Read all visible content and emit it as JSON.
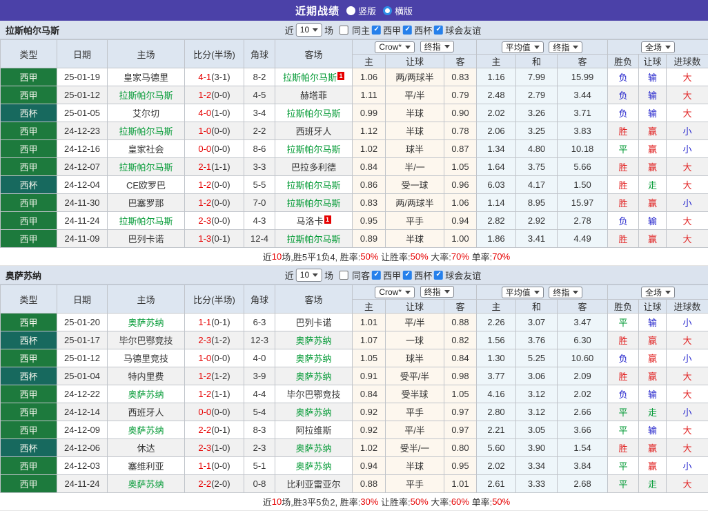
{
  "topbar": {
    "title": "近期战绩",
    "radio_vertical_label": "竖版",
    "radio_horizontal_label": "横版"
  },
  "filters": {
    "near": "近",
    "count": "10",
    "matches": "场",
    "league": "西甲",
    "cup": "西杯",
    "friendly": "球会友谊"
  },
  "controls": {
    "odds_source": "Crow*",
    "final_index1": "终指",
    "average": "平均值",
    "final_index2": "终指",
    "full_match": "全场"
  },
  "cols": {
    "type": "类型",
    "date": "日期",
    "home": "主场",
    "score": "比分(半场)",
    "corner": "角球",
    "away": "客场",
    "h": "主",
    "handicap": "让球",
    "a": "客",
    "h2": "主",
    "d": "和",
    "a2": "客",
    "wdl": "胜负",
    "handicap2": "让球",
    "goals": "进球数"
  },
  "sections": [
    {
      "team": "拉斯帕尔马斯",
      "same_label": "同主",
      "rows": [
        {
          "type": "西甲",
          "tc": "jia",
          "date": "25-01-19",
          "home": "皇家马德里",
          "hh": 0,
          "hb": "",
          "ft": "4-1",
          "ht": "(3-1)",
          "corner": "8-2",
          "away": "拉斯帕尔马斯",
          "ah": 1,
          "ab": "1",
          "o": [
            "1.06",
            "两/两球半",
            "0.83",
            "1.16",
            "7.99",
            "15.99"
          ],
          "r": [
            [
              "负",
              "b"
            ],
            [
              "输",
              "b"
            ],
            [
              "大",
              "r"
            ]
          ]
        },
        {
          "type": "西甲",
          "tc": "jia",
          "date": "25-01-12",
          "home": "拉斯帕尔马斯",
          "hh": 1,
          "hb": "",
          "ft": "1-2",
          "ht": "(0-0)",
          "corner": "4-5",
          "away": "赫塔菲",
          "ah": 0,
          "ab": "",
          "o": [
            "1.11",
            "平/半",
            "0.79",
            "2.48",
            "2.79",
            "3.44"
          ],
          "r": [
            [
              "负",
              "b"
            ],
            [
              "输",
              "b"
            ],
            [
              "大",
              "r"
            ]
          ]
        },
        {
          "type": "西杯",
          "tc": "bei",
          "date": "25-01-05",
          "home": "艾尔切",
          "hh": 0,
          "hb": "",
          "ft": "4-0",
          "ht": "(1-0)",
          "corner": "3-4",
          "away": "拉斯帕尔马斯",
          "ah": 1,
          "ab": "",
          "o": [
            "0.99",
            "半球",
            "0.90",
            "2.02",
            "3.26",
            "3.71"
          ],
          "r": [
            [
              "负",
              "b"
            ],
            [
              "输",
              "b"
            ],
            [
              "大",
              "r"
            ]
          ]
        },
        {
          "type": "西甲",
          "tc": "jia",
          "date": "24-12-23",
          "home": "拉斯帕尔马斯",
          "hh": 1,
          "hb": "",
          "ft": "1-0",
          "ht": "(0-0)",
          "corner": "2-2",
          "away": "西班牙人",
          "ah": 0,
          "ab": "",
          "o": [
            "1.12",
            "半球",
            "0.78",
            "2.06",
            "3.25",
            "3.83"
          ],
          "r": [
            [
              "胜",
              "r"
            ],
            [
              "赢",
              "r"
            ],
            [
              "小",
              "b"
            ]
          ]
        },
        {
          "type": "西甲",
          "tc": "jia",
          "date": "24-12-16",
          "home": "皇家社会",
          "hh": 0,
          "hb": "",
          "ft": "0-0",
          "ht": "(0-0)",
          "corner": "8-6",
          "away": "拉斯帕尔马斯",
          "ah": 1,
          "ab": "",
          "o": [
            "1.02",
            "球半",
            "0.87",
            "1.34",
            "4.80",
            "10.18"
          ],
          "r": [
            [
              "平",
              "g"
            ],
            [
              "赢",
              "r"
            ],
            [
              "小",
              "b"
            ]
          ]
        },
        {
          "type": "西甲",
          "tc": "jia",
          "date": "24-12-07",
          "home": "拉斯帕尔马斯",
          "hh": 1,
          "hb": "",
          "ft": "2-1",
          "ht": "(1-1)",
          "corner": "3-3",
          "away": "巴拉多利德",
          "ah": 0,
          "ab": "",
          "o": [
            "0.84",
            "半/一",
            "1.05",
            "1.64",
            "3.75",
            "5.66"
          ],
          "r": [
            [
              "胜",
              "r"
            ],
            [
              "赢",
              "r"
            ],
            [
              "大",
              "r"
            ]
          ]
        },
        {
          "type": "西杯",
          "tc": "bei",
          "date": "24-12-04",
          "home": "CE欧罗巴",
          "hh": 0,
          "hb": "",
          "ft": "1-2",
          "ht": "(0-0)",
          "corner": "5-5",
          "away": "拉斯帕尔马斯",
          "ah": 1,
          "ab": "",
          "o": [
            "0.86",
            "受一球",
            "0.96",
            "6.03",
            "4.17",
            "1.50"
          ],
          "r": [
            [
              "胜",
              "r"
            ],
            [
              "走",
              "g"
            ],
            [
              "大",
              "r"
            ]
          ]
        },
        {
          "type": "西甲",
          "tc": "jia",
          "date": "24-11-30",
          "home": "巴塞罗那",
          "hh": 0,
          "hb": "",
          "ft": "1-2",
          "ht": "(0-0)",
          "corner": "7-0",
          "away": "拉斯帕尔马斯",
          "ah": 1,
          "ab": "",
          "o": [
            "0.83",
            "两/两球半",
            "1.06",
            "1.14",
            "8.95",
            "15.97"
          ],
          "r": [
            [
              "胜",
              "r"
            ],
            [
              "赢",
              "r"
            ],
            [
              "小",
              "b"
            ]
          ]
        },
        {
          "type": "西甲",
          "tc": "jia",
          "date": "24-11-24",
          "home": "拉斯帕尔马斯",
          "hh": 1,
          "hb": "",
          "ft": "2-3",
          "ht": "(0-0)",
          "corner": "4-3",
          "away": "马洛卡",
          "ah": 0,
          "ab": "1",
          "o": [
            "0.95",
            "平手",
            "0.94",
            "2.82",
            "2.92",
            "2.78"
          ],
          "r": [
            [
              "负",
              "b"
            ],
            [
              "输",
              "b"
            ],
            [
              "大",
              "r"
            ]
          ]
        },
        {
          "type": "西甲",
          "tc": "jia",
          "date": "24-11-09",
          "home": "巴列卡诺",
          "hh": 0,
          "hb": "",
          "ft": "1-3",
          "ht": "(0-1)",
          "corner": "12-4",
          "away": "拉斯帕尔马斯",
          "ah": 1,
          "ab": "",
          "o": [
            "0.89",
            "半球",
            "1.00",
            "1.86",
            "3.41",
            "4.49"
          ],
          "r": [
            [
              "胜",
              "r"
            ],
            [
              "赢",
              "r"
            ],
            [
              "大",
              "r"
            ]
          ]
        }
      ],
      "summary": {
        "l1": "近",
        "v1": "10",
        "l2": "场,胜5平1负4, 胜率:",
        "v2": "50%",
        "l3": " 让胜率:",
        "v3": "50%",
        "l4": " 大率:",
        "v4": "70%",
        "l5": " 单率:",
        "v5": "70%"
      }
    },
    {
      "team": "奥萨苏纳",
      "same_label": "同客",
      "rows": [
        {
          "type": "西甲",
          "tc": "jia",
          "date": "25-01-20",
          "home": "奥萨苏纳",
          "hh": 1,
          "hb": "",
          "ft": "1-1",
          "ht": "(0-1)",
          "corner": "6-3",
          "away": "巴列卡诺",
          "ah": 0,
          "ab": "",
          "o": [
            "1.01",
            "平/半",
            "0.88",
            "2.26",
            "3.07",
            "3.47"
          ],
          "r": [
            [
              "平",
              "g"
            ],
            [
              "输",
              "b"
            ],
            [
              "小",
              "b"
            ]
          ]
        },
        {
          "type": "西杯",
          "tc": "bei",
          "date": "25-01-17",
          "home": "毕尔巴鄂竞技",
          "hh": 0,
          "hb": "",
          "ft": "2-3",
          "ht": "(1-2)",
          "corner": "12-3",
          "away": "奥萨苏纳",
          "ah": 1,
          "ab": "",
          "o": [
            "1.07",
            "一球",
            "0.82",
            "1.56",
            "3.76",
            "6.30"
          ],
          "r": [
            [
              "胜",
              "r"
            ],
            [
              "赢",
              "r"
            ],
            [
              "大",
              "r"
            ]
          ]
        },
        {
          "type": "西甲",
          "tc": "jia",
          "date": "25-01-12",
          "home": "马德里竞技",
          "hh": 0,
          "hb": "",
          "ft": "1-0",
          "ht": "(0-0)",
          "corner": "4-0",
          "away": "奥萨苏纳",
          "ah": 1,
          "ab": "",
          "o": [
            "1.05",
            "球半",
            "0.84",
            "1.30",
            "5.25",
            "10.60"
          ],
          "r": [
            [
              "负",
              "b"
            ],
            [
              "赢",
              "r"
            ],
            [
              "小",
              "b"
            ]
          ]
        },
        {
          "type": "西杯",
          "tc": "bei",
          "date": "25-01-04",
          "home": "特内里费",
          "hh": 0,
          "hb": "",
          "ft": "1-2",
          "ht": "(1-2)",
          "corner": "3-9",
          "away": "奥萨苏纳",
          "ah": 1,
          "ab": "",
          "o": [
            "0.91",
            "受平/半",
            "0.98",
            "3.77",
            "3.06",
            "2.09"
          ],
          "r": [
            [
              "胜",
              "r"
            ],
            [
              "赢",
              "r"
            ],
            [
              "大",
              "r"
            ]
          ]
        },
        {
          "type": "西甲",
          "tc": "jia",
          "date": "24-12-22",
          "home": "奥萨苏纳",
          "hh": 1,
          "hb": "",
          "ft": "1-2",
          "ht": "(1-1)",
          "corner": "4-4",
          "away": "毕尔巴鄂竞技",
          "ah": 0,
          "ab": "",
          "o": [
            "0.84",
            "受半球",
            "1.05",
            "4.16",
            "3.12",
            "2.02"
          ],
          "r": [
            [
              "负",
              "b"
            ],
            [
              "输",
              "b"
            ],
            [
              "大",
              "r"
            ]
          ]
        },
        {
          "type": "西甲",
          "tc": "jia",
          "date": "24-12-14",
          "home": "西班牙人",
          "hh": 0,
          "hb": "",
          "ft": "0-0",
          "ht": "(0-0)",
          "corner": "5-4",
          "away": "奥萨苏纳",
          "ah": 1,
          "ab": "",
          "o": [
            "0.92",
            "平手",
            "0.97",
            "2.80",
            "3.12",
            "2.66"
          ],
          "r": [
            [
              "平",
              "g"
            ],
            [
              "走",
              "g"
            ],
            [
              "小",
              "b"
            ]
          ]
        },
        {
          "type": "西甲",
          "tc": "jia",
          "date": "24-12-09",
          "home": "奥萨苏纳",
          "hh": 1,
          "hb": "",
          "ft": "2-2",
          "ht": "(0-1)",
          "corner": "8-3",
          "away": "阿拉维斯",
          "ah": 0,
          "ab": "",
          "o": [
            "0.92",
            "平/半",
            "0.97",
            "2.21",
            "3.05",
            "3.66"
          ],
          "r": [
            [
              "平",
              "g"
            ],
            [
              "输",
              "b"
            ],
            [
              "大",
              "r"
            ]
          ]
        },
        {
          "type": "西杯",
          "tc": "bei",
          "date": "24-12-06",
          "home": "休达",
          "hh": 0,
          "hb": "",
          "ft": "2-3",
          "ht": "(1-0)",
          "corner": "2-3",
          "away": "奥萨苏纳",
          "ah": 1,
          "ab": "",
          "o": [
            "1.02",
            "受半/一",
            "0.80",
            "5.60",
            "3.90",
            "1.54"
          ],
          "r": [
            [
              "胜",
              "r"
            ],
            [
              "赢",
              "r"
            ],
            [
              "大",
              "r"
            ]
          ]
        },
        {
          "type": "西甲",
          "tc": "jia",
          "date": "24-12-03",
          "home": "塞维利亚",
          "hh": 0,
          "hb": "",
          "ft": "1-1",
          "ht": "(0-0)",
          "corner": "5-1",
          "away": "奥萨苏纳",
          "ah": 1,
          "ab": "",
          "o": [
            "0.94",
            "半球",
            "0.95",
            "2.02",
            "3.34",
            "3.84"
          ],
          "r": [
            [
              "平",
              "g"
            ],
            [
              "赢",
              "r"
            ],
            [
              "小",
              "b"
            ]
          ]
        },
        {
          "type": "西甲",
          "tc": "jia",
          "date": "24-11-24",
          "home": "奥萨苏纳",
          "hh": 1,
          "hb": "",
          "ft": "2-2",
          "ht": "(2-0)",
          "corner": "0-8",
          "away": "比利亚雷亚尔",
          "ah": 0,
          "ab": "",
          "o": [
            "0.88",
            "平手",
            "1.01",
            "2.61",
            "3.33",
            "2.68"
          ],
          "r": [
            [
              "平",
              "g"
            ],
            [
              "走",
              "g"
            ],
            [
              "大",
              "r"
            ]
          ]
        }
      ],
      "summary": {
        "l1": "近",
        "v1": "10",
        "l2": "场,胜3平5负2, 胜率:",
        "v2": "30%",
        "l3": " 让胜率:",
        "v3": "50%",
        "l4": " 大率:",
        "v4": "60%",
        "l5": " 单率:",
        "v5": "50%"
      }
    }
  ]
}
